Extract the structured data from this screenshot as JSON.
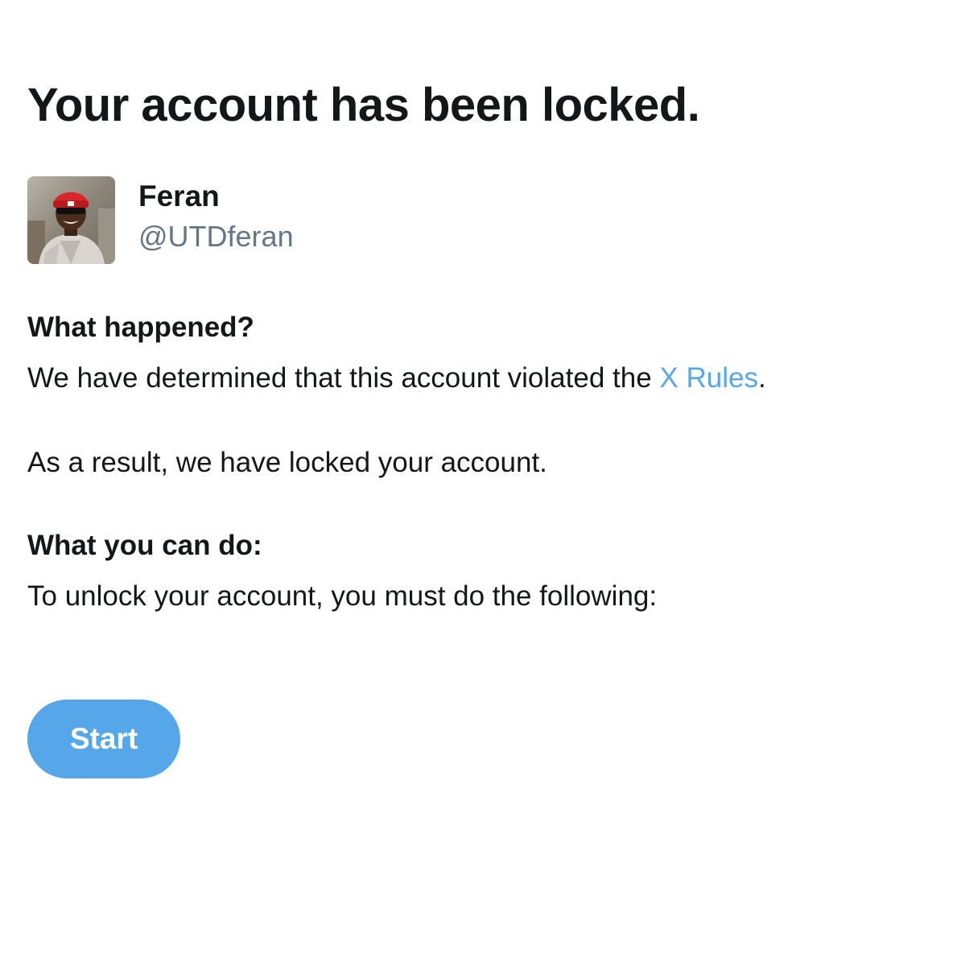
{
  "title": "Your account has been locked.",
  "account": {
    "display_name": "Feran",
    "handle": "@UTDferan",
    "avatar_icon": "profile-photo"
  },
  "what_happened": {
    "heading": "What happened?",
    "text_before_link": "We have determined that this account violated the ",
    "link_label": "X Rules",
    "text_after_link": ".",
    "result_text": "As a result, we have locked your account."
  },
  "what_you_can_do": {
    "heading": "What you can do:",
    "text": "To unlock your account, you must do the following:"
  },
  "actions": {
    "start_label": "Start"
  },
  "colors": {
    "text": "#14171a",
    "secondary_text": "#657786",
    "accent": "#55a7ea",
    "background": "#ffffff"
  }
}
